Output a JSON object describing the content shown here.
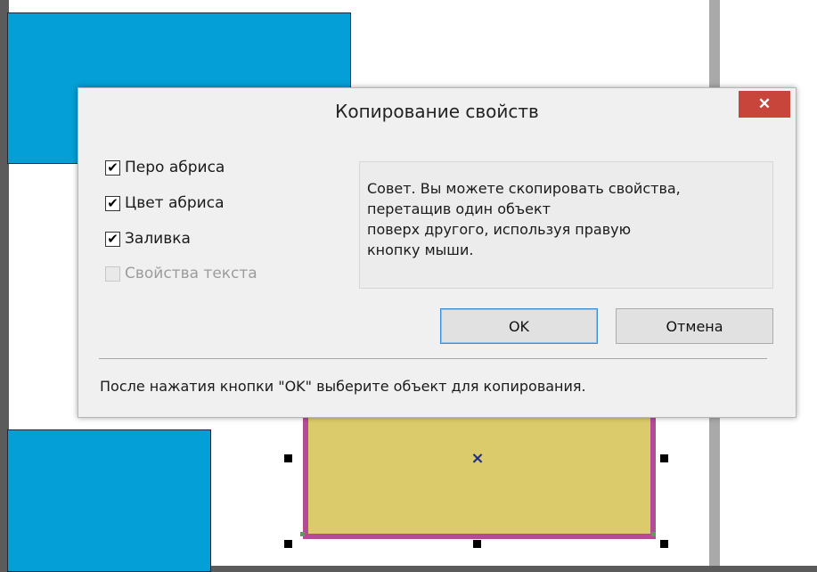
{
  "dialog": {
    "title": "Копирование свойств",
    "close_symbol": "✕",
    "checkboxes": [
      {
        "label": "Перо абриса",
        "checked": true,
        "enabled": true
      },
      {
        "label": "Цвет абриса",
        "checked": true,
        "enabled": true
      },
      {
        "label": "Заливка",
        "checked": true,
        "enabled": true
      },
      {
        "label": "Свойства текста",
        "checked": false,
        "enabled": false
      }
    ],
    "tip_lines": [
      "Совет. Вы можете скопировать свойства,",
      "перетащив один объект",
      "поверх другого, используя правую",
      "кнопку мыши."
    ],
    "ok_label": "OK",
    "cancel_label": "Отмена",
    "footer": "После нажатия кнопки \"OK\" выберите объект для копирования."
  },
  "canvas": {
    "center_marker": "×",
    "colors": {
      "blue_fill": "#039fd6",
      "yellow_fill": "#dccb6a",
      "magenta_outline": "#b24c96"
    }
  },
  "check_glyph": "✔"
}
